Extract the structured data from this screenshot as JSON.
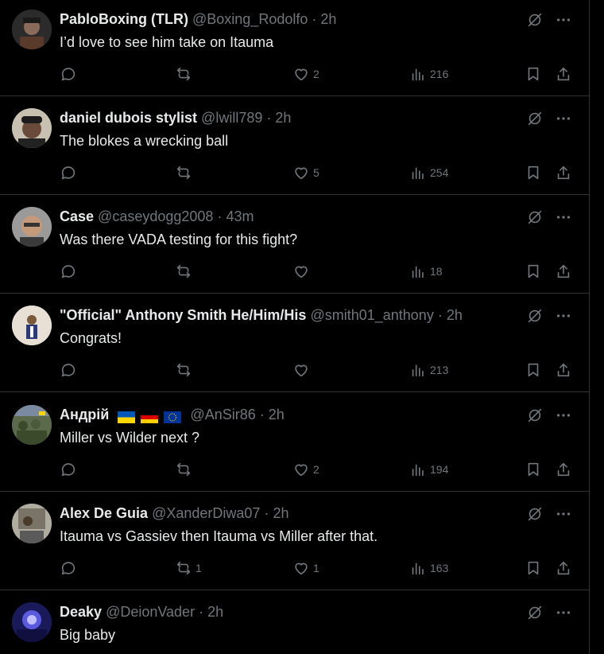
{
  "tweets": [
    {
      "name": "PabloBoxing (TLR)",
      "handle": "@Boxing_Rodolfo",
      "time": "2h",
      "text": "I’d love to see him take on Itauma",
      "replies": "",
      "retweets": "",
      "likes": "2",
      "views": "216",
      "avatar_color": "#3a3a3a"
    },
    {
      "name": "daniel dubois stylist",
      "handle": "@lwill789",
      "time": "2h",
      "text": "The blokes a wrecking ball",
      "replies": "",
      "retweets": "",
      "likes": "5",
      "views": "254",
      "avatar_color": "#5a4a3a"
    },
    {
      "name": "Case",
      "handle": "@caseydogg2008",
      "time": "43m",
      "text": "Was there VADA testing for this fight?",
      "replies": "",
      "retweets": "",
      "likes": "",
      "views": "18",
      "avatar_color": "#6b5b4b"
    },
    {
      "name": "\"Official\" Anthony Smith He/Him/His",
      "handle": "@smith01_anthony",
      "time": "2h",
      "text": "Congrats!",
      "replies": "",
      "retweets": "",
      "likes": "",
      "views": "213",
      "avatar_color": "#c9c2b6"
    },
    {
      "name": "Андрій",
      "handle": "@AnSir86",
      "time": "2h",
      "text": "Miller vs Wilder next ?",
      "replies": "",
      "retweets": "",
      "likes": "2",
      "views": "194",
      "avatar_color": "#4a6a4a"
    },
    {
      "name": "Alex De Guia",
      "handle": "@XanderDiwa07",
      "time": "2h",
      "text": "Itauma vs Gassiev then Itauma vs Miller after that.",
      "replies": "",
      "retweets": "1",
      "likes": "1",
      "views": "163",
      "avatar_color": "#8a8a80"
    },
    {
      "name": "Deaky",
      "handle": "@DeionVader",
      "time": "2h",
      "text": "Big baby",
      "replies": "",
      "retweets": "",
      "likes": "",
      "views": "",
      "avatar_color": "#2a2a8a"
    }
  ],
  "separator": "·",
  "colors": {
    "background": "#000000",
    "text": "#e7e9ea",
    "muted": "#71767b",
    "border": "#2f3336"
  }
}
